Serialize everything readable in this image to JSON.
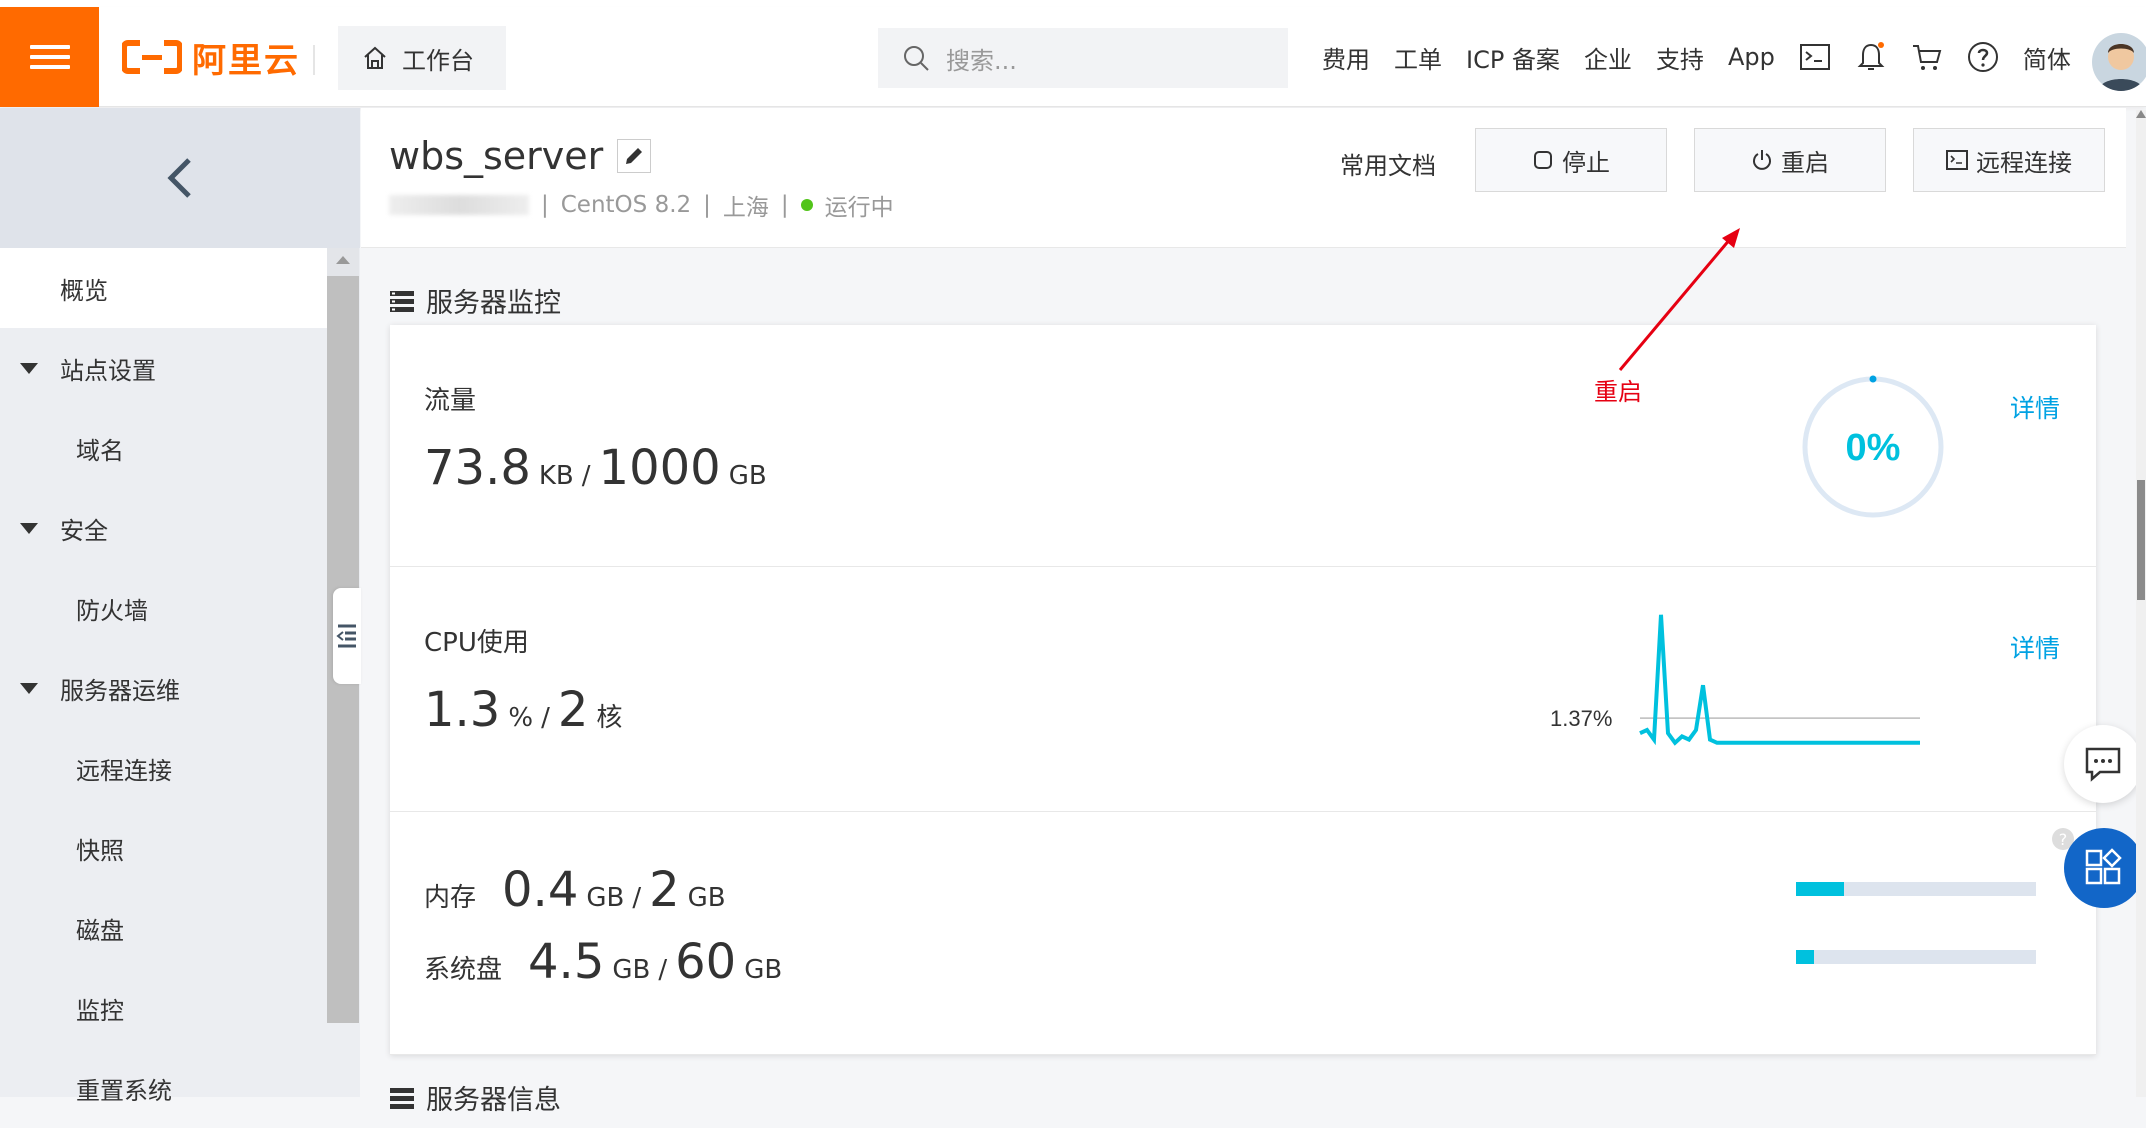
{
  "topbar": {
    "brand": "阿里云",
    "workbench_label": "工作台",
    "search_placeholder": "搜索...",
    "nav": [
      "费用",
      "工单",
      "ICP 备案",
      "企业",
      "支持",
      "App"
    ],
    "lang": "简体",
    "colors": {
      "brand": "#ff6a00"
    }
  },
  "sidebar": {
    "items": [
      {
        "label": "概览",
        "type": "item",
        "active": true
      },
      {
        "label": "站点设置",
        "type": "group"
      },
      {
        "label": "域名",
        "type": "sub"
      },
      {
        "label": "安全",
        "type": "group"
      },
      {
        "label": "防火墙",
        "type": "sub"
      },
      {
        "label": "服务器运维",
        "type": "group"
      },
      {
        "label": "远程连接",
        "type": "sub"
      },
      {
        "label": "快照",
        "type": "sub"
      },
      {
        "label": "磁盘",
        "type": "sub"
      },
      {
        "label": "监控",
        "type": "sub"
      },
      {
        "label": "重置系统",
        "type": "sub"
      }
    ]
  },
  "server": {
    "name": "wbs_server",
    "os": "CentOS 8.2",
    "region": "上海",
    "status": "运行中",
    "status_color": "#52c41a"
  },
  "actions": {
    "docs": "常用文档",
    "stop": "停止",
    "restart": "重启",
    "remote": "远程连接"
  },
  "annotation": {
    "label": "重启",
    "color": "#e60012"
  },
  "monitor": {
    "title": "服务器监控",
    "traffic": {
      "label": "流量",
      "used": "73.8",
      "used_unit": "KB",
      "sep": "/",
      "total": "1000",
      "total_unit": "GB",
      "percent": "0%",
      "detail": "详情"
    },
    "cpu": {
      "label": "CPU使用",
      "used": "1.3",
      "used_unit": "%",
      "sep": "/",
      "cores": "2",
      "cores_unit": "核",
      "peak_label": "1.37%",
      "detail": "详情"
    },
    "memory": {
      "label": "内存",
      "used": "0.4",
      "used_unit": "GB",
      "sep": "/",
      "total": "2",
      "total_unit": "GB",
      "fill": 0.2
    },
    "disk": {
      "label": "系统盘",
      "used": "4.5",
      "used_unit": "GB",
      "sep": "/",
      "total": "60",
      "total_unit": "GB",
      "fill": 0.075
    }
  },
  "info": {
    "title": "服务器信息"
  },
  "chart_data": {
    "type": "line",
    "x": [
      0,
      1,
      2,
      3,
      4,
      5,
      6,
      7,
      8,
      9,
      10,
      11,
      12,
      13,
      14,
      15,
      16,
      17,
      18,
      19,
      20,
      21,
      22,
      23,
      24,
      25,
      26,
      27,
      28,
      29,
      30,
      31,
      32,
      33,
      34,
      35,
      36,
      37,
      38,
      39,
      40
    ],
    "values": [
      0.9,
      1.0,
      0.7,
      4.6,
      0.9,
      0.6,
      0.8,
      0.7,
      1.0,
      2.4,
      0.7,
      0.6,
      0.6,
      0.6,
      0.6,
      0.6,
      0.6,
      0.6,
      0.6,
      0.6,
      0.6,
      0.6,
      0.6,
      0.6,
      0.6,
      0.6,
      0.6,
      0.6,
      0.6,
      0.6,
      0.6,
      0.6,
      0.6,
      0.6,
      0.6,
      0.6,
      0.6,
      0.6,
      0.6,
      0.6,
      0.6
    ],
    "reference_line": 1.37,
    "ylim": [
      0,
      5
    ],
    "color": "#00c1de"
  }
}
